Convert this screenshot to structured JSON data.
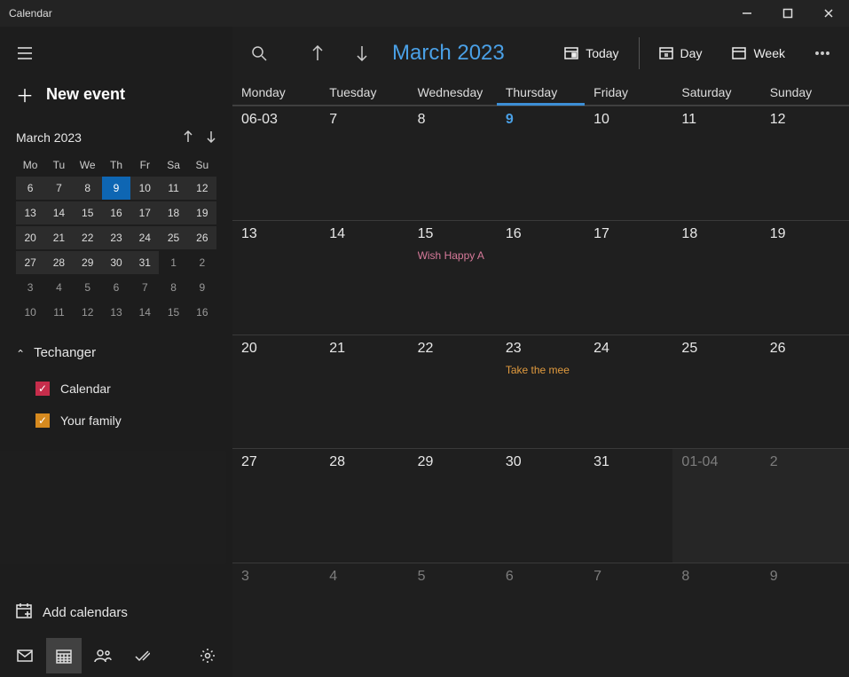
{
  "titlebar": {
    "app_name": "Calendar"
  },
  "sidebar": {
    "new_event_label": "New event",
    "mini": {
      "header": "March 2023",
      "dow": [
        "Mo",
        "Tu",
        "We",
        "Th",
        "Fr",
        "Sa",
        "Su"
      ],
      "cells": [
        {
          "n": "6",
          "cur": true
        },
        {
          "n": "7",
          "cur": true
        },
        {
          "n": "8",
          "cur": true
        },
        {
          "n": "9",
          "cur": true,
          "today": true
        },
        {
          "n": "10",
          "cur": true
        },
        {
          "n": "11",
          "cur": true
        },
        {
          "n": "12",
          "cur": true
        },
        {
          "n": "13",
          "cur": true
        },
        {
          "n": "14",
          "cur": true
        },
        {
          "n": "15",
          "cur": true
        },
        {
          "n": "16",
          "cur": true
        },
        {
          "n": "17",
          "cur": true
        },
        {
          "n": "18",
          "cur": true
        },
        {
          "n": "19",
          "cur": true
        },
        {
          "n": "20",
          "cur": true
        },
        {
          "n": "21",
          "cur": true
        },
        {
          "n": "22",
          "cur": true
        },
        {
          "n": "23",
          "cur": true
        },
        {
          "n": "24",
          "cur": true
        },
        {
          "n": "25",
          "cur": true
        },
        {
          "n": "26",
          "cur": true
        },
        {
          "n": "27",
          "cur": true
        },
        {
          "n": "28",
          "cur": true
        },
        {
          "n": "29",
          "cur": true
        },
        {
          "n": "30",
          "cur": true
        },
        {
          "n": "31",
          "cur": true
        },
        {
          "n": "1"
        },
        {
          "n": "2"
        },
        {
          "n": "3"
        },
        {
          "n": "4"
        },
        {
          "n": "5"
        },
        {
          "n": "6"
        },
        {
          "n": "7"
        },
        {
          "n": "8"
        },
        {
          "n": "9"
        },
        {
          "n": "10"
        },
        {
          "n": "11"
        },
        {
          "n": "12"
        },
        {
          "n": "13"
        },
        {
          "n": "14"
        },
        {
          "n": "15"
        },
        {
          "n": "16"
        }
      ]
    },
    "account": "Techanger",
    "calendars": [
      {
        "label": "Calendar",
        "color": "red"
      },
      {
        "label": "Your family",
        "color": "orange"
      }
    ],
    "add_calendars_label": "Add calendars"
  },
  "toolbar": {
    "title": "March 2023",
    "today": "Today",
    "day": "Day",
    "week": "Week"
  },
  "dow": [
    "Monday",
    "Tuesday",
    "Wednesday",
    "Thursday",
    "Friday",
    "Saturday",
    "Sunday"
  ],
  "today_col_index": 3,
  "grid": [
    [
      {
        "n": "06-03"
      },
      {
        "n": "7"
      },
      {
        "n": "8"
      },
      {
        "n": "9",
        "today": true
      },
      {
        "n": "10"
      },
      {
        "n": "11"
      },
      {
        "n": "12"
      }
    ],
    [
      {
        "n": "13"
      },
      {
        "n": "14"
      },
      {
        "n": "15",
        "evt": {
          "text": "Wish Happy A",
          "cls": "pink"
        }
      },
      {
        "n": "16"
      },
      {
        "n": "17"
      },
      {
        "n": "18"
      },
      {
        "n": "19"
      }
    ],
    [
      {
        "n": "20"
      },
      {
        "n": "21"
      },
      {
        "n": "22"
      },
      {
        "n": "23",
        "evt": {
          "text": "Take the mee",
          "cls": "orange"
        }
      },
      {
        "n": "24"
      },
      {
        "n": "25"
      },
      {
        "n": "26"
      }
    ],
    [
      {
        "n": "27"
      },
      {
        "n": "28"
      },
      {
        "n": "29"
      },
      {
        "n": "30"
      },
      {
        "n": "31"
      },
      {
        "n": "01-04",
        "next": true,
        "dim": true
      },
      {
        "n": "2",
        "next": true,
        "dim": true
      }
    ],
    [
      {
        "n": "3",
        "dim": true
      },
      {
        "n": "4",
        "dim": true
      },
      {
        "n": "5",
        "dim": true
      },
      {
        "n": "6",
        "dim": true
      },
      {
        "n": "7",
        "dim": true
      },
      {
        "n": "8",
        "dim": true
      },
      {
        "n": "9",
        "dim": true
      }
    ]
  ]
}
